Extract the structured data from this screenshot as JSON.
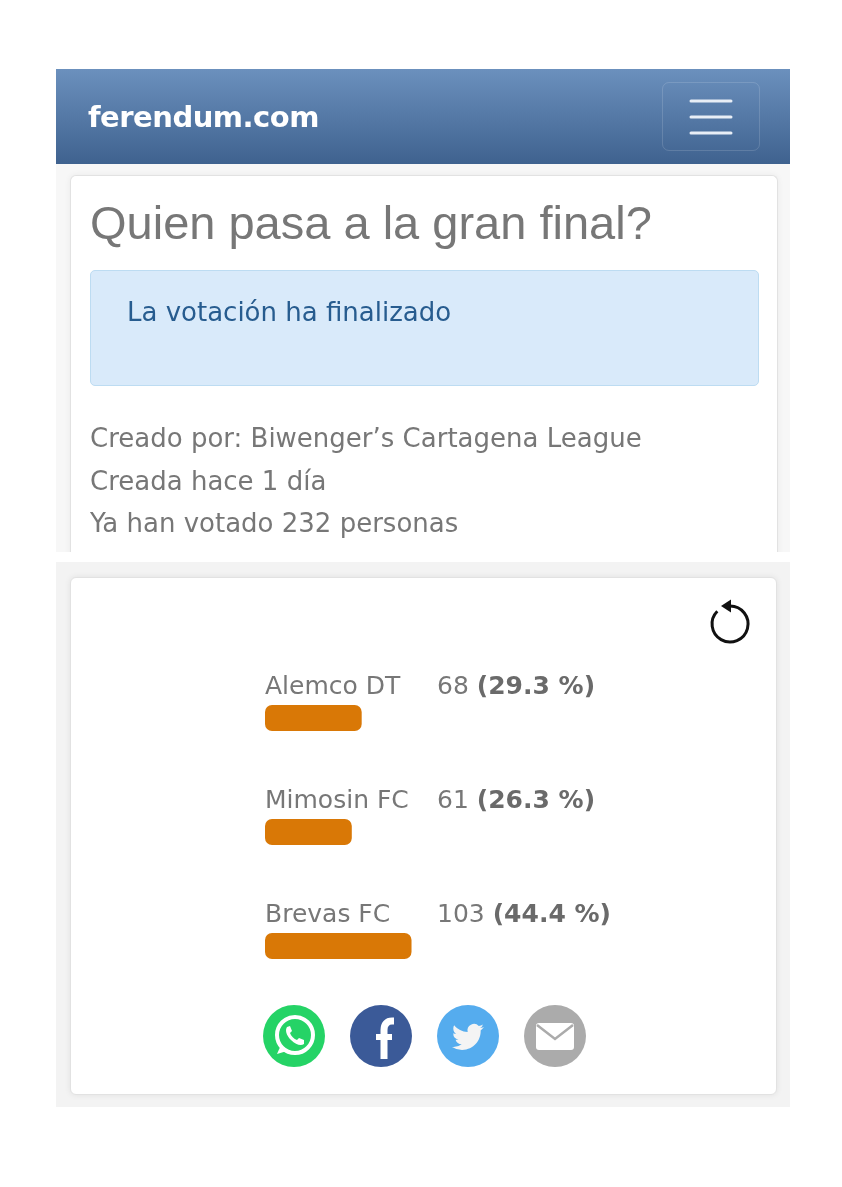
{
  "navbar": {
    "brand": "ferendum.com"
  },
  "poll": {
    "title": "Quien pasa a la gran final?",
    "status_alert": "La votación ha finalizado",
    "details": [
      "Creado por: Biwenger’s Cartagena League",
      "Creada hace 1 día",
      "Ya han votado 232 personas"
    ]
  },
  "results": {
    "options": [
      {
        "name": "Alemco DT",
        "votes": "68 **(29.3 %)**",
        "level": 0.293
      },
      {
        "name": "Mimosin FC",
        "votes": "61 **(26.3 %)**",
        "level": 0.263
      },
      {
        "name": "Brevas FC",
        "votes": "103 **(44.4 %)**",
        "level": 0.444
      }
    ],
    "share_buttons": [
      {
        "kind": "whatsapp"
      },
      {
        "kind": "facebook"
      },
      {
        "kind": "twitter"
      },
      {
        "kind": "email"
      }
    ]
  }
}
